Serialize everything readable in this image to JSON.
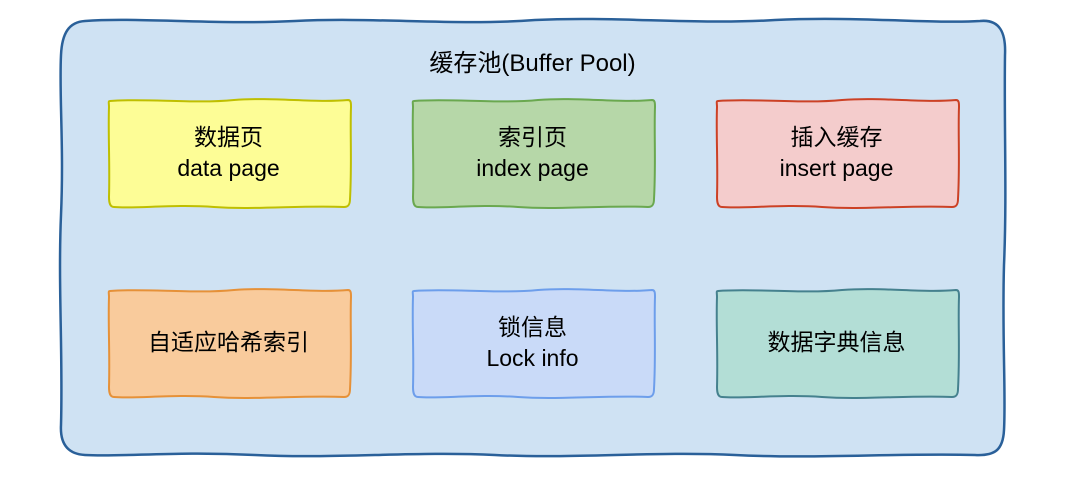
{
  "title": "缓存池(Buffer Pool)",
  "container": {
    "fill": "#cfe2f3",
    "stroke": "#2a6099"
  },
  "boxes": [
    {
      "line1": "数据页",
      "line2": "data page",
      "fill": "#fdfd96",
      "stroke": "#bfbf00"
    },
    {
      "line1": "索引页",
      "line2": "index page",
      "fill": "#b6d7a8",
      "stroke": "#6aa84f"
    },
    {
      "line1": "插入缓存",
      "line2": "insert page",
      "fill": "#f4cccc",
      "stroke": "#cc4125"
    },
    {
      "line1": "自适应哈希索引",
      "line2": "",
      "fill": "#f9cb9c",
      "stroke": "#e69138"
    },
    {
      "line1": "锁信息",
      "line2": "Lock info",
      "fill": "#c9daf8",
      "stroke": "#6d9eeb"
    },
    {
      "line1": "数据字典信息",
      "line2": "",
      "fill": "#b3ded6",
      "stroke": "#45818e"
    }
  ]
}
